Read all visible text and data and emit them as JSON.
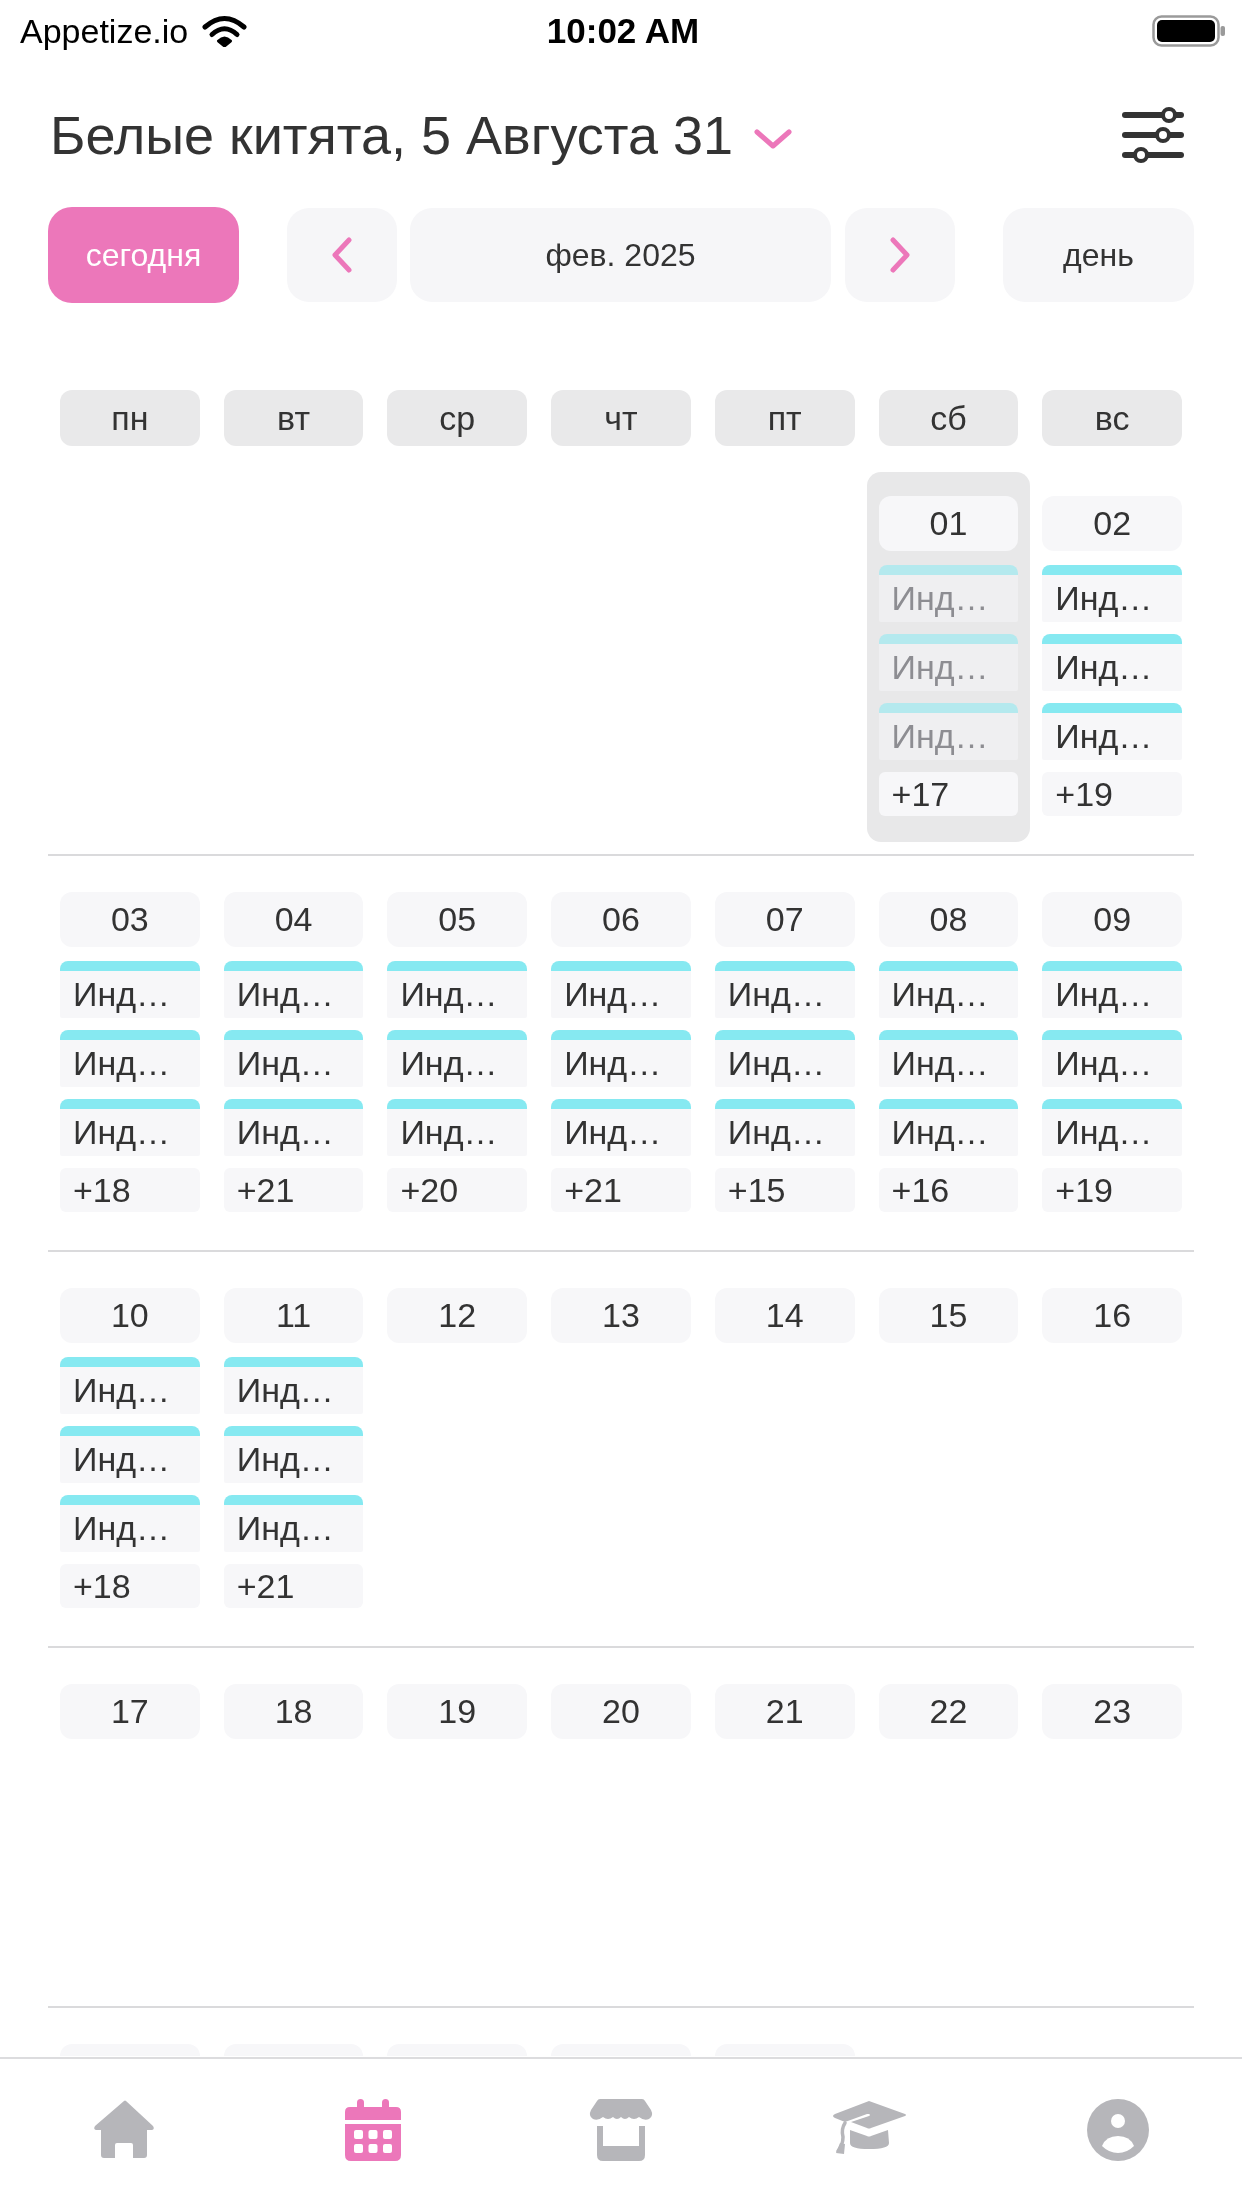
{
  "status_bar": {
    "carrier": "Appetize.io",
    "time": "10:02 AM"
  },
  "header": {
    "title": "Белые китята, 5 Августа 31"
  },
  "toolbar": {
    "today_button": "сегодня",
    "month": "фев. 2025",
    "view_button": "день"
  },
  "weekdays": [
    "пн",
    "вт",
    "ср",
    "чт",
    "пт",
    "сб",
    "вс"
  ],
  "weeks": [
    {
      "days": [
        {
          "kind": "empty"
        },
        {
          "kind": "empty"
        },
        {
          "kind": "empty"
        },
        {
          "kind": "empty"
        },
        {
          "kind": "empty"
        },
        {
          "kind": "day",
          "number": "01",
          "selected": true,
          "events": [
            {
              "label": "Инд…",
              "disabled": true
            },
            {
              "label": "Инд…",
              "disabled": true
            },
            {
              "label": "Инд…",
              "disabled": true
            }
          ],
          "more": "+17"
        },
        {
          "kind": "day",
          "number": "02",
          "selected": false,
          "events": [
            {
              "label": "Инд…",
              "disabled": false
            },
            {
              "label": "Инд…",
              "disabled": false
            },
            {
              "label": "Инд…",
              "disabled": false
            }
          ],
          "more": "+19"
        }
      ]
    },
    {
      "days": [
        {
          "kind": "day",
          "number": "03",
          "selected": false,
          "events": [
            {
              "label": "Инд…",
              "disabled": false
            },
            {
              "label": "Инд…",
              "disabled": false
            },
            {
              "label": "Инд…",
              "disabled": false
            }
          ],
          "more": "+18"
        },
        {
          "kind": "day",
          "number": "04",
          "selected": false,
          "events": [
            {
              "label": "Инд…",
              "disabled": false
            },
            {
              "label": "Инд…",
              "disabled": false
            },
            {
              "label": "Инд…",
              "disabled": false
            }
          ],
          "more": "+21"
        },
        {
          "kind": "day",
          "number": "05",
          "selected": false,
          "events": [
            {
              "label": "Инд…",
              "disabled": false
            },
            {
              "label": "Инд…",
              "disabled": false
            },
            {
              "label": "Инд…",
              "disabled": false
            }
          ],
          "more": "+20"
        },
        {
          "kind": "day",
          "number": "06",
          "selected": false,
          "events": [
            {
              "label": "Инд…",
              "disabled": false
            },
            {
              "label": "Инд…",
              "disabled": false
            },
            {
              "label": "Инд…",
              "disabled": false
            }
          ],
          "more": "+21"
        },
        {
          "kind": "day",
          "number": "07",
          "selected": false,
          "events": [
            {
              "label": "Инд…",
              "disabled": false
            },
            {
              "label": "Инд…",
              "disabled": false
            },
            {
              "label": "Инд…",
              "disabled": false
            }
          ],
          "more": "+15"
        },
        {
          "kind": "day",
          "number": "08",
          "selected": false,
          "events": [
            {
              "label": "Инд…",
              "disabled": false
            },
            {
              "label": "Инд…",
              "disabled": false
            },
            {
              "label": "Инд…",
              "disabled": false
            }
          ],
          "more": "+16"
        },
        {
          "kind": "day",
          "number": "09",
          "selected": false,
          "events": [
            {
              "label": "Инд…",
              "disabled": false
            },
            {
              "label": "Инд…",
              "disabled": false
            },
            {
              "label": "Инд…",
              "disabled": false
            }
          ],
          "more": "+19"
        }
      ]
    },
    {
      "days": [
        {
          "kind": "day",
          "number": "10",
          "selected": false,
          "events": [
            {
              "label": "Инд…",
              "disabled": false
            },
            {
              "label": "Инд…",
              "disabled": false
            },
            {
              "label": "Инд…",
              "disabled": false
            }
          ],
          "more": "+18"
        },
        {
          "kind": "day",
          "number": "11",
          "selected": false,
          "events": [
            {
              "label": "Инд…",
              "disabled": false
            },
            {
              "label": "Инд…",
              "disabled": false
            },
            {
              "label": "Инд…",
              "disabled": false
            }
          ],
          "more": "+21"
        },
        {
          "kind": "day",
          "number": "12",
          "selected": false
        },
        {
          "kind": "day",
          "number": "13",
          "selected": false
        },
        {
          "kind": "day",
          "number": "14",
          "selected": false
        },
        {
          "kind": "day",
          "number": "15",
          "selected": false
        },
        {
          "kind": "day",
          "number": "16",
          "selected": false
        }
      ]
    },
    {
      "days": [
        {
          "kind": "day",
          "number": "17",
          "selected": false
        },
        {
          "kind": "day",
          "number": "18",
          "selected": false
        },
        {
          "kind": "day",
          "number": "19",
          "selected": false
        },
        {
          "kind": "day",
          "number": "20",
          "selected": false
        },
        {
          "kind": "day",
          "number": "21",
          "selected": false
        },
        {
          "kind": "day",
          "number": "22",
          "selected": false
        },
        {
          "kind": "day",
          "number": "23",
          "selected": false
        }
      ]
    },
    {
      "days": [
        {
          "kind": "day",
          "selected": false
        },
        {
          "kind": "day",
          "selected": false
        },
        {
          "kind": "day",
          "selected": false
        },
        {
          "kind": "day",
          "selected": false
        },
        {
          "kind": "day",
          "selected": false
        },
        {
          "kind": "empty"
        },
        {
          "kind": "empty"
        }
      ]
    }
  ],
  "tab_bar": [
    {
      "kind": "home",
      "selected": false
    },
    {
      "kind": "calendar",
      "selected": true
    },
    {
      "kind": "store",
      "selected": false
    },
    {
      "kind": "education",
      "selected": false
    },
    {
      "kind": "profile",
      "selected": false
    }
  ]
}
